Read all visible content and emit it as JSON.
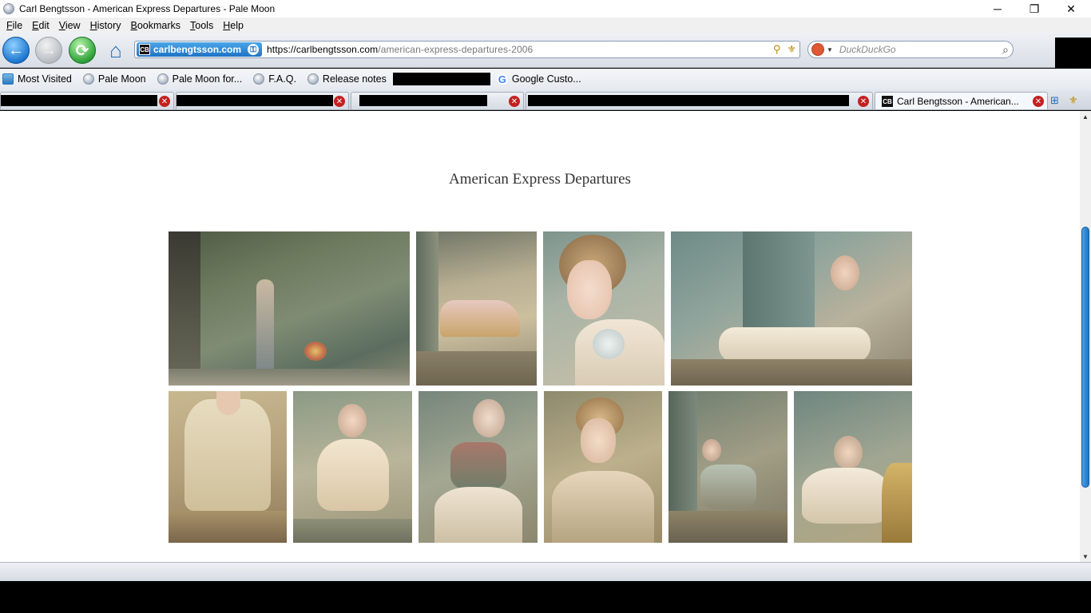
{
  "window": {
    "title": "Carl Bengtsson - American Express Departures - Pale Moon",
    "minimize_glyph": "─",
    "maximize_glyph": "❐",
    "close_glyph": "✕"
  },
  "menu": [
    {
      "label": "File",
      "accesskey": "F",
      "rest": "ile"
    },
    {
      "label": "Edit",
      "accesskey": "E",
      "rest": "dit"
    },
    {
      "label": "View",
      "accesskey": "V",
      "rest": "iew"
    },
    {
      "label": "History",
      "accesskey": "H",
      "rest": "istory"
    },
    {
      "label": "Bookmarks",
      "accesskey": "B",
      "rest": "ookmarks"
    },
    {
      "label": "Tools",
      "accesskey": "T",
      "rest": "ools"
    },
    {
      "label": "Help",
      "accesskey": "H",
      "rest": "elp"
    }
  ],
  "navbar": {
    "back_glyph": "←",
    "forward_glyph": "→",
    "reload_glyph": "⟳",
    "home_glyph": "⌂",
    "identity_label": "carlbengtsson.com",
    "identity_favicon": "CB",
    "url_host": "https://carlbengtsson.com",
    "url_path": "/american-express-departures-2006",
    "search_placeholder": "DuckDuckGo",
    "downloads_glyph": "⇩"
  },
  "bookmarks": [
    {
      "label": "Most Visited",
      "icon": "star-folder-icon"
    },
    {
      "label": "Pale Moon",
      "icon": "globe-icon"
    },
    {
      "label": "Pale Moon for...",
      "icon": "globe-icon"
    },
    {
      "label": "F.A.Q.",
      "icon": "globe-icon"
    },
    {
      "label": "Release notes",
      "icon": "globe-icon"
    },
    {
      "label": "Google Custo...",
      "icon": "google-icon"
    }
  ],
  "tabs": {
    "active_label": "Carl Bengtsson - American...",
    "active_favicon": "CB"
  },
  "page": {
    "heading": "American Express Departures"
  },
  "colors": {
    "accent": "#1e73c4",
    "page_background": "#ffffff",
    "heading": "#333333"
  }
}
